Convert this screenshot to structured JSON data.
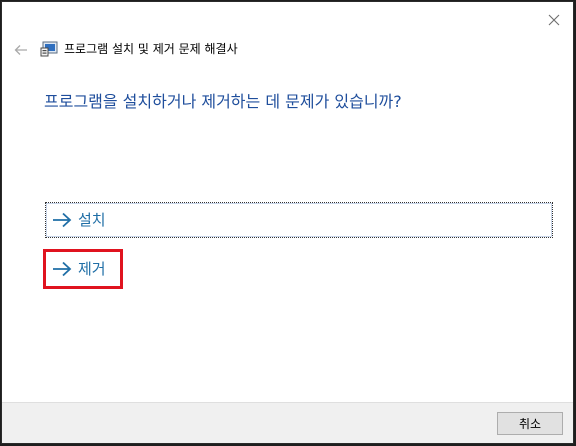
{
  "window": {
    "title": "프로그램 설치 및 제거 문제 해결사",
    "close_icon": "close-icon",
    "back_icon": "back-arrow-icon",
    "app_icon": "troubleshooter-icon"
  },
  "main": {
    "question": "프로그램을 설치하거나 제거하는 데 문제가 있습니까?",
    "options": [
      {
        "label": "설치",
        "icon": "arrow-right-icon"
      },
      {
        "label": "제거",
        "icon": "arrow-right-icon",
        "highlight_color": "#e0131f"
      }
    ]
  },
  "footer": {
    "cancel_label": "취소"
  },
  "colors": {
    "accent_text": "#1f4e9c",
    "link_text": "#1f6ea6"
  }
}
